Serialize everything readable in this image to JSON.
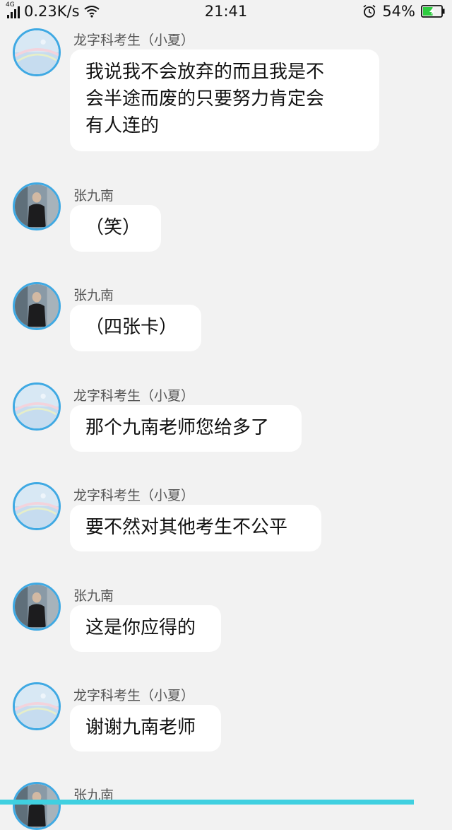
{
  "status_bar": {
    "network_type": "4G",
    "speed": "0.23K/s",
    "time": "21:41",
    "battery": "54%",
    "battery_level": 0.54,
    "icons": [
      "signal-icon",
      "wifi-icon",
      "alarm-icon",
      "battery-icon"
    ]
  },
  "colors": {
    "background": "#f2f2f2",
    "bubble": "#ffffff",
    "avatar_ring": "#3fa9e3",
    "battery_fill": "#2ecc40",
    "bottom_strip": "#40d0e0"
  },
  "messages": [
    {
      "sender": "龙字科考生（小夏）",
      "avatar": "pastel-sky-avatar",
      "lines": [
        "我说我不会放弃的而且我是不",
        "会半途而废的只要努力肯定会",
        "有人连的"
      ]
    },
    {
      "sender": "张九南",
      "avatar": "man-in-black-avatar",
      "lines": [
        "（笑）"
      ]
    },
    {
      "sender": "张九南",
      "avatar": "man-in-black-avatar",
      "lines": [
        "（四张卡）"
      ]
    },
    {
      "sender": "龙字科考生（小夏）",
      "avatar": "pastel-sky-avatar",
      "lines": [
        "那个九南老师您给多了"
      ]
    },
    {
      "sender": "龙字科考生（小夏）",
      "avatar": "pastel-sky-avatar",
      "lines": [
        "要不然对其他考生不公平"
      ]
    },
    {
      "sender": "张九南",
      "avatar": "man-in-black-avatar",
      "lines": [
        "这是你应得的"
      ]
    },
    {
      "sender": "龙字科考生（小夏）",
      "avatar": "pastel-sky-avatar",
      "lines": [
        "谢谢九南老师"
      ]
    },
    {
      "sender": "张九南",
      "avatar": "man-in-black-avatar",
      "lines": []
    }
  ]
}
